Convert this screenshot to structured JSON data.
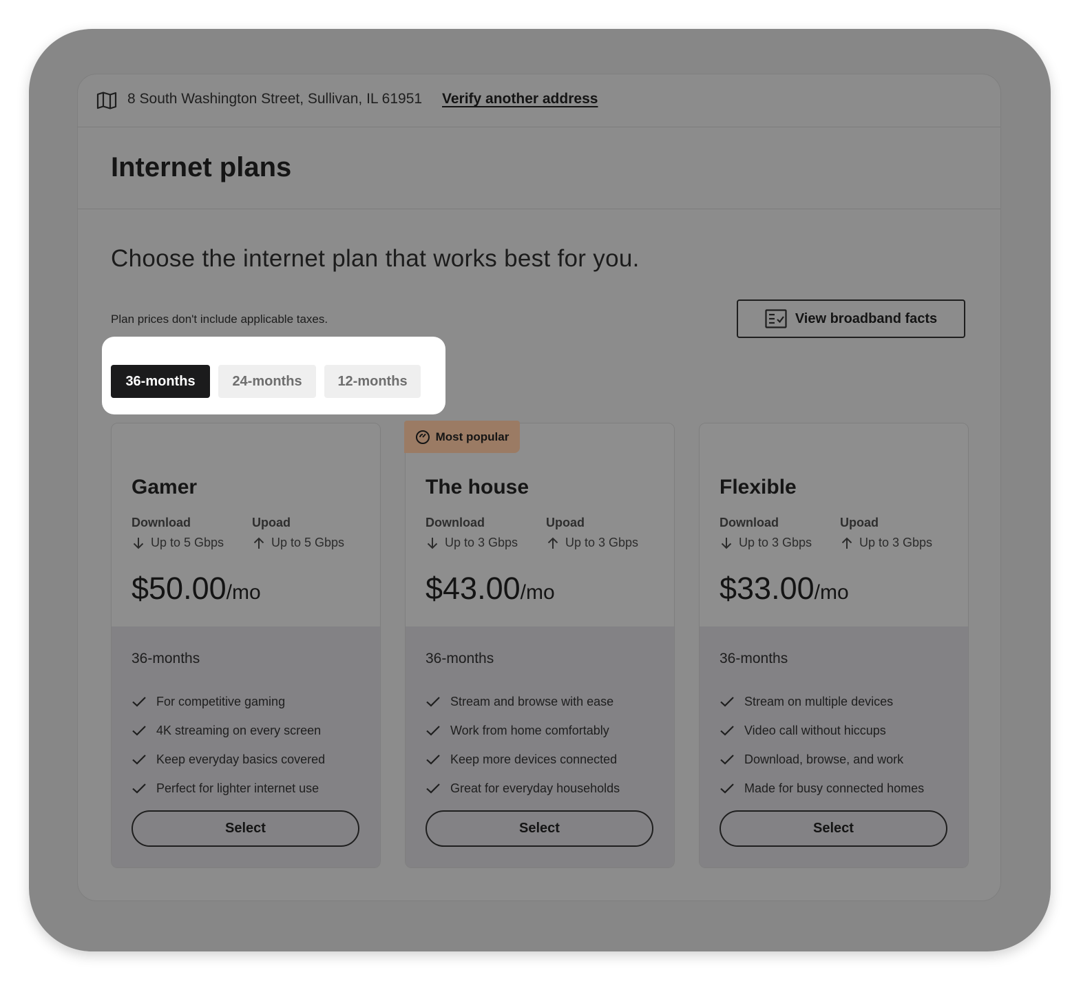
{
  "address": {
    "text": "8 South Washington Street, Sullivan, IL 61951",
    "verify_link": "Verify another address"
  },
  "page_title": "Internet plans",
  "subtitle": "Choose the internet plan that works best for you.",
  "tax_note": "Plan prices don't include applicable taxes.",
  "broadband_button": "View broadband facts",
  "tabs": [
    {
      "label": "36-months",
      "active": true
    },
    {
      "label": "24-months",
      "active": false
    },
    {
      "label": "12-months",
      "active": false
    }
  ],
  "badge": "Most popular",
  "colors": {
    "frame": "#878787",
    "panel": "#8c8c8c",
    "active_tab": "#1b1b1c",
    "badge": "#9b7b64"
  },
  "labels": {
    "download": "Download",
    "upload": "Upoad",
    "per": "/mo",
    "select": "Select"
  },
  "plans": [
    {
      "name": "Gamer",
      "download": "Up to 5 Gbps",
      "upload": "Up to 5 Gbps",
      "price": "$50.00",
      "term": "36-months",
      "features": [
        "For competitive gaming",
        "4K streaming on every screen",
        "Keep everyday basics covered",
        "Perfect for lighter internet use"
      ]
    },
    {
      "name": "The house",
      "download": "Up to 3 Gbps",
      "upload": "Up to 3 Gbps",
      "price": "$43.00",
      "term": "36-months",
      "features": [
        "Stream and browse with ease",
        "Work from home comfortably",
        "Keep more devices connected",
        "Great for everyday households"
      ]
    },
    {
      "name": "Flexible",
      "download": "Up to 3 Gbps",
      "upload": "Up to 3 Gbps",
      "price": "$33.00",
      "term": "36-months",
      "features": [
        "Stream on multiple devices",
        "Video call without hiccups",
        "Download, browse, and work",
        "Made for busy connected homes"
      ]
    }
  ]
}
